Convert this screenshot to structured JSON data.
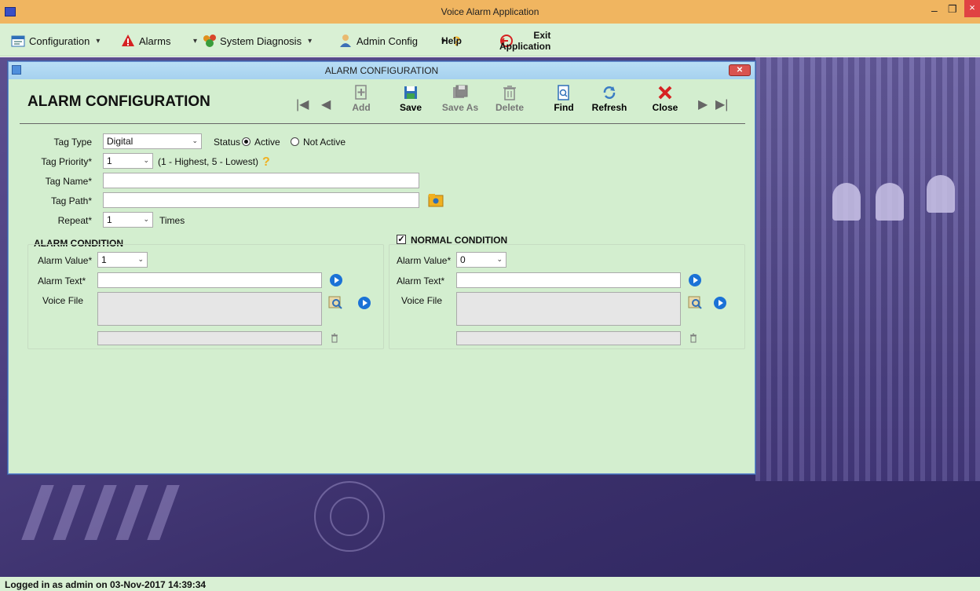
{
  "window": {
    "title": "Voice Alarm Application",
    "min": "–",
    "restore": "❐",
    "close": "×"
  },
  "menu": {
    "configuration": "Configuration",
    "alarms": "Alarms",
    "system_diagnosis": "System Diagnosis",
    "admin_config": "Admin Config",
    "help": "Help",
    "exit": "Exit Application",
    "arrow": "▾"
  },
  "child": {
    "title": "ALARM CONFIGURATION",
    "close": "✕",
    "heading": "ALARM CONFIGURATION"
  },
  "toolbar": {
    "first": "|◀",
    "prev": "◀",
    "add": "Add",
    "save": "Save",
    "save_as": "Save As",
    "delete": "Delete",
    "find": "Find",
    "refresh": "Refresh",
    "close": "Close",
    "next": "▶",
    "last": "▶|"
  },
  "form": {
    "tag_type_label": "Tag Type",
    "tag_type_value": "Digital",
    "status_label": "Status",
    "status_active": "Active",
    "status_not_active": "Not Active",
    "status_selected": "Active",
    "tag_priority_label": "Tag Priority*",
    "tag_priority_value": "1",
    "priority_hint": "(1 - Highest, 5 - Lowest)",
    "tag_name_label": "Tag Name*",
    "tag_name_value": "",
    "tag_path_label": "Tag Path*",
    "tag_path_value": "",
    "repeat_label": "Repeat*",
    "repeat_value": "1",
    "repeat_unit": "Times",
    "dropdown_arrow": "⌄"
  },
  "alarm_condition": {
    "title": "ALARM CONDITION",
    "alarm_value_label": "Alarm Value*",
    "alarm_value": "1",
    "alarm_text_label": "Alarm Text*",
    "alarm_text_value": "",
    "voice_file_label": "Voice File"
  },
  "normal_condition": {
    "title": "NORMAL CONDITION",
    "checked": true,
    "check_mark": "✓",
    "alarm_value_label": "Alarm Value*",
    "alarm_value": "0",
    "alarm_text_label": "Alarm Text*",
    "alarm_text_value": "",
    "voice_file_label": "Voice File"
  },
  "status_bar": {
    "text": "Logged in as admin on 03-Nov-2017 14:39:34"
  },
  "colors": {
    "title_bar": "#f0b560",
    "menu_bar": "#d9f0d4",
    "form_bg": "#d3eecf",
    "accent_blue": "#1b72d6",
    "close_red": "#e04343"
  }
}
